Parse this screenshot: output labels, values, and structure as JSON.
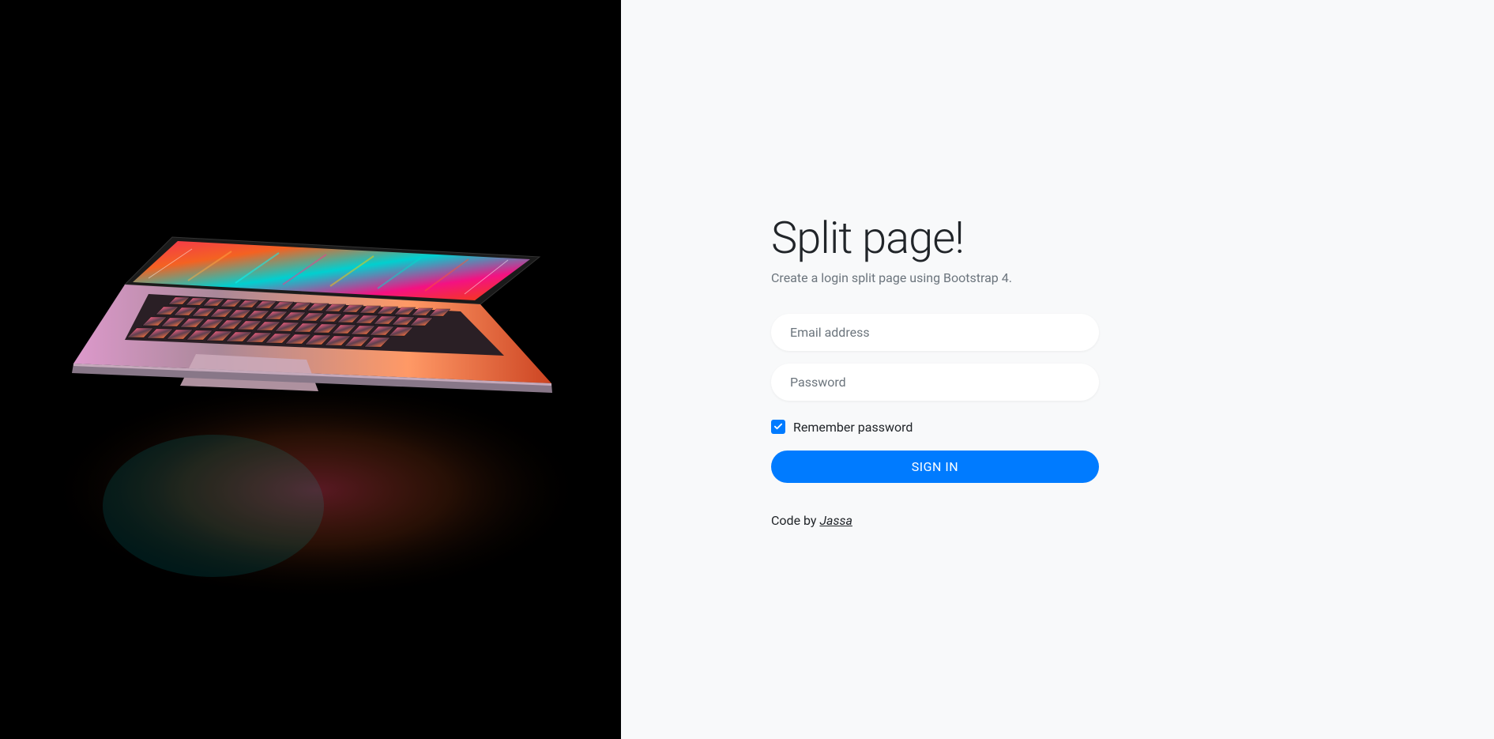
{
  "heading": {
    "title": "Split page!",
    "subtitle": "Create a login split page using Bootstrap 4."
  },
  "form": {
    "email": {
      "placeholder": "Email address",
      "value": ""
    },
    "password": {
      "placeholder": "Password",
      "value": ""
    },
    "remember": {
      "label": "Remember password",
      "checked": true
    },
    "submit_label": "Sign in"
  },
  "footer": {
    "prefix": "Code by ",
    "link_text": "Jassa"
  },
  "colors": {
    "primary": "#007bff",
    "panel_bg": "#f8f9fa",
    "text_muted": "#6c757d",
    "text_body": "#212529"
  }
}
